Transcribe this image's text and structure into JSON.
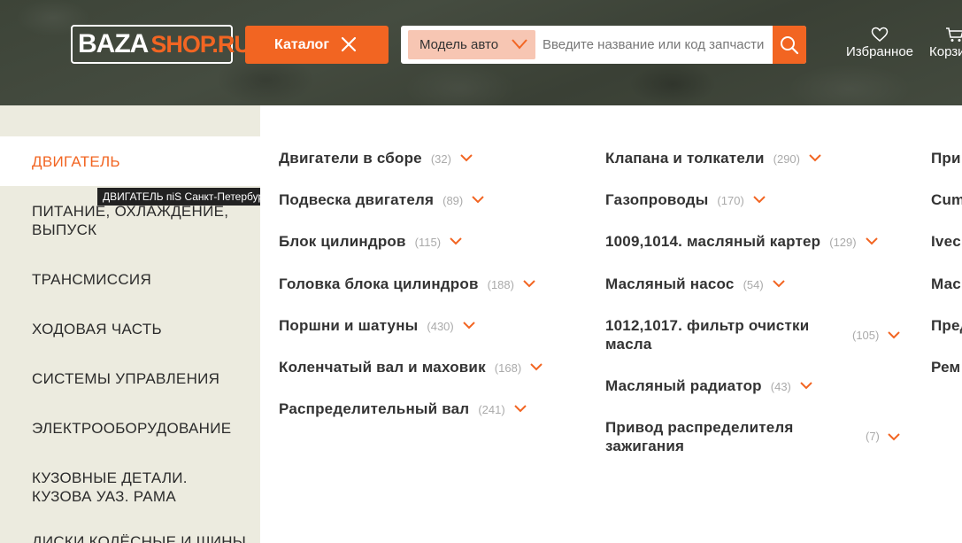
{
  "header": {
    "logo_part1": "BAZA",
    "logo_part2": "SHOP.RU",
    "catalog_label": "Каталог",
    "model_select_value": "Модель авто",
    "search_placeholder": "Введите название или код запчасти",
    "favorites_label": "Избранное",
    "cart_label": "Корзина"
  },
  "sidebar": {
    "items": [
      {
        "label": "ДВИГАТЕЛЬ",
        "active": true
      },
      {
        "label": "ПИТАНИЕ, ОХЛАЖДЕНИЕ, ВЫПУСК"
      },
      {
        "label": "ТРАНСМИССИЯ"
      },
      {
        "label": "ХОДОВАЯ ЧАСТЬ"
      },
      {
        "label": "СИСТЕМЫ УПРАВЛЕНИЯ"
      },
      {
        "label": "ЭЛЕКТРООБОРУДОВАНИЕ"
      },
      {
        "label": "КУЗОВНЫЕ ДЕТАЛИ. КУЗОВА УАЗ. РАМА"
      },
      {
        "label": "ДИСКИ КОЛЁСНЫЕ И ШИНЫ"
      }
    ],
    "tooltip": "ДВИГАТЕЛЬ піЅ Санкт-Петербурге"
  },
  "columns": {
    "col1": [
      {
        "label": "Двигатели в сборе",
        "count": "(32)"
      },
      {
        "label": "Подвеска двигателя",
        "count": "(89)"
      },
      {
        "label": "Блок цилиндров",
        "count": "(115)"
      },
      {
        "label": "Головка блока цилиндров",
        "count": "(188)"
      },
      {
        "label": "Поршни и шатуны",
        "count": "(430)"
      },
      {
        "label": "Коленчатый вал и маховик",
        "count": "(168)"
      },
      {
        "label": "Распределительный вал",
        "count": "(241)"
      }
    ],
    "col2": [
      {
        "label": "Клапана и толкатели",
        "count": "(290)"
      },
      {
        "label": "Газопроводы",
        "count": "(170)"
      },
      {
        "label": "1009,1014. масляный картер",
        "count": "(129)"
      },
      {
        "label": "Масляный насос",
        "count": "(54)"
      },
      {
        "label": "1012,1017. фильтр очистки масла",
        "count": "(105)"
      },
      {
        "label": "Масляный радиатор",
        "count": "(43)"
      },
      {
        "label": "Привод распределителя зажигания",
        "count": "(7)"
      }
    ],
    "col3": [
      {
        "label": "При"
      },
      {
        "label": "Cum"
      },
      {
        "label": "Ivec"
      },
      {
        "label": "Мас"
      },
      {
        "label": "Пред"
      },
      {
        "label": "Рем"
      }
    ]
  },
  "colors": {
    "accent": "#f26522",
    "sidebar_bg": "#ecebdf",
    "header_bg": "#404739"
  }
}
